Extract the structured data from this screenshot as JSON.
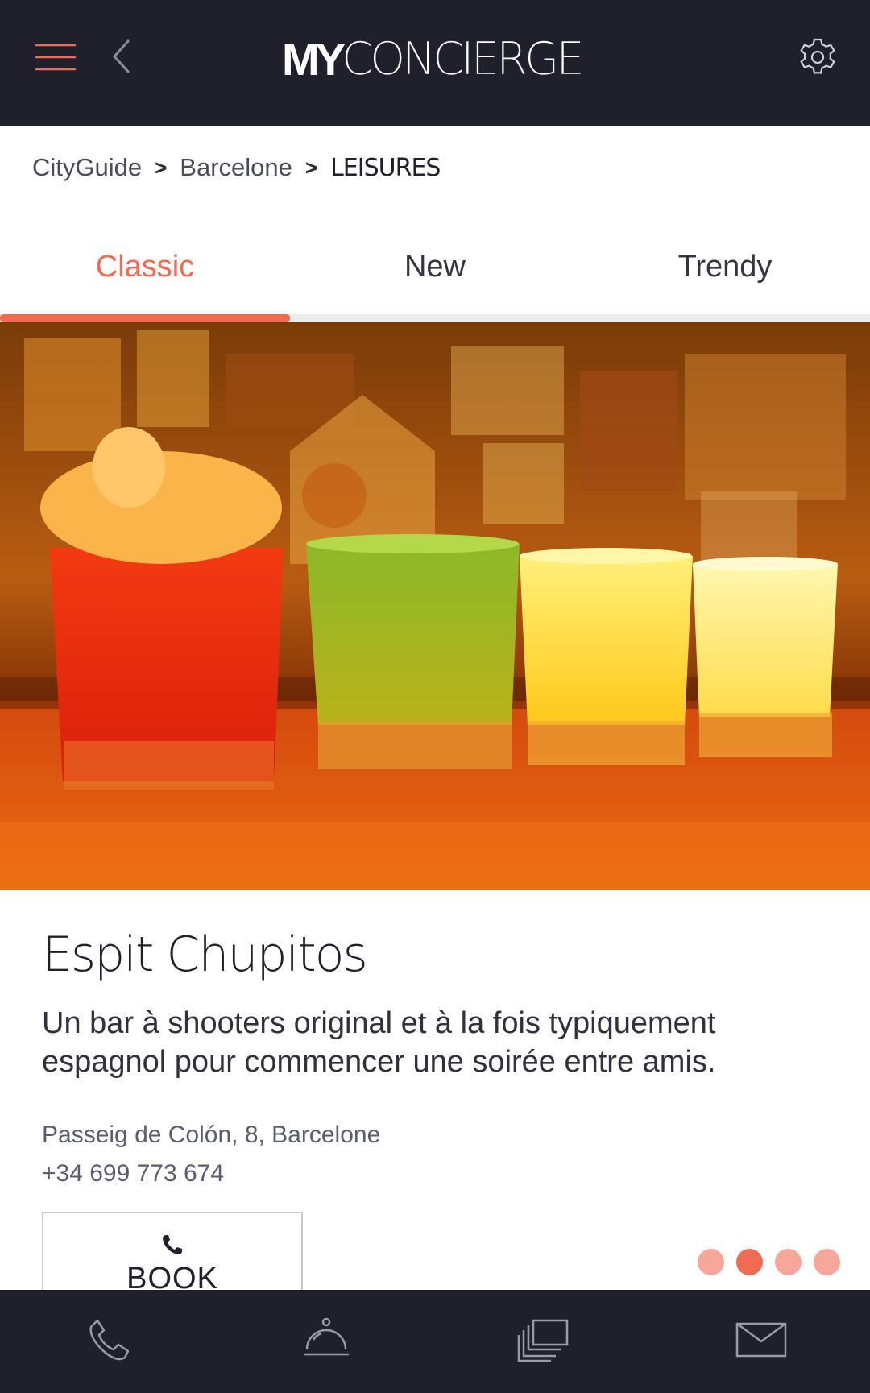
{
  "app": {
    "logo_bold": "MY",
    "logo_light": "CONCIERGE"
  },
  "header": {
    "icons": [
      "hamburger-menu-icon",
      "back-chevron-icon",
      "gear-icon"
    ]
  },
  "breadcrumb": {
    "items": [
      "CityGuide",
      "Barcelone",
      "LEISURES"
    ],
    "separator": ">"
  },
  "tabs": [
    {
      "label": "Classic",
      "active": true
    },
    {
      "label": "New",
      "active": false
    },
    {
      "label": "Trendy",
      "active": false
    }
  ],
  "venue": {
    "title": "Espit Chupitos",
    "description": "Un bar à shooters original et à la fois typiquement espagnol pour commencer une soirée entre amis.",
    "address": "Passeig de Colón, 8, Barcelone",
    "phone": "+34 699 773 674",
    "book_label": "BOOK"
  },
  "carousel": {
    "count": 4,
    "active_index": 1
  },
  "bottom_nav": {
    "icons": [
      "phone-icon",
      "concierge-bell-icon",
      "gallery-icon",
      "mail-icon"
    ]
  },
  "colors": {
    "accent": "#f06a54",
    "bar": "#1f202c",
    "dot_inactive": "#f7a79a"
  }
}
